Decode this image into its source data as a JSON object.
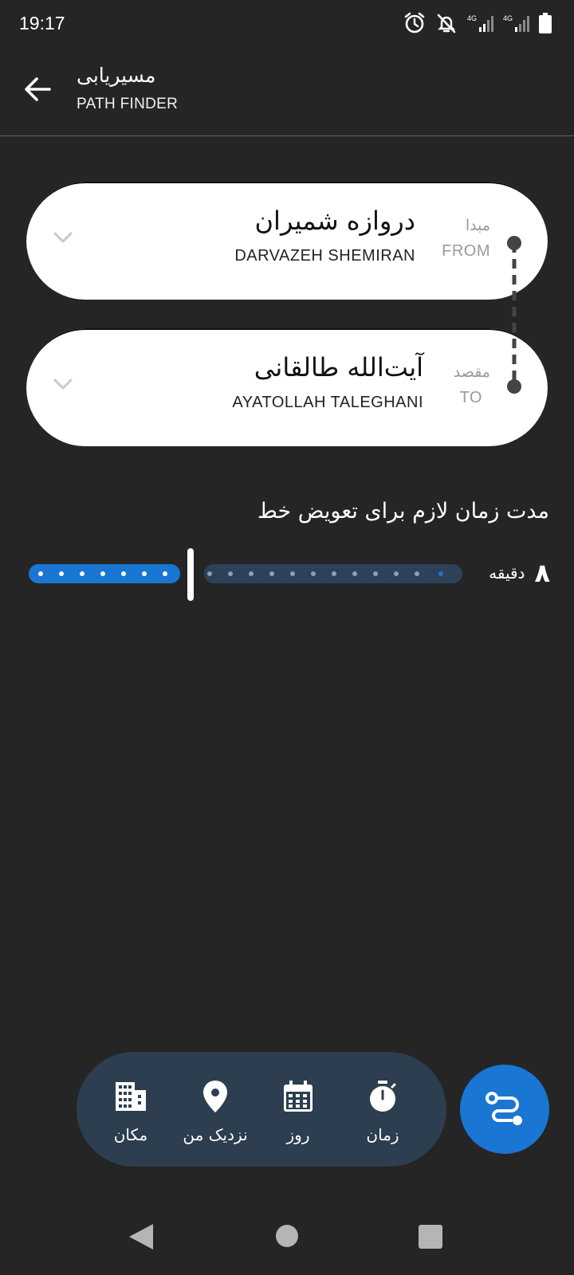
{
  "status_bar": {
    "time": "19:17",
    "network_1": "4G",
    "network_2": "4G"
  },
  "app_bar": {
    "title_fa": "مسیریابی",
    "title_en": "PATH FINDER"
  },
  "origin": {
    "role_fa": "مبدا",
    "role_en": "FROM",
    "station_fa": "دروازه شمیران",
    "station_en": "DARVAZEH SHEMIRAN"
  },
  "destination": {
    "role_fa": "مقصد",
    "role_en": "TO",
    "station_fa": "آیت‌الله طالقانی",
    "station_en": "AYATOLLAH TALEGHANI"
  },
  "transfer": {
    "title": "مدت زمان لازم برای تعویض خط",
    "value": "۸",
    "unit": "دقیقه",
    "selected_fraction": 0.38
  },
  "bottom_options": [
    {
      "label": "زمان",
      "icon": "stopwatch-icon"
    },
    {
      "label": "روز",
      "icon": "calendar-icon"
    },
    {
      "label": "نزدیک من",
      "icon": "location-pin-icon"
    },
    {
      "label": "مکان",
      "icon": "building-icon"
    }
  ],
  "fab": {
    "icon": "route-icon"
  },
  "colors": {
    "accent": "#1976d2",
    "pill": "#2c3e50",
    "background": "#252525"
  }
}
